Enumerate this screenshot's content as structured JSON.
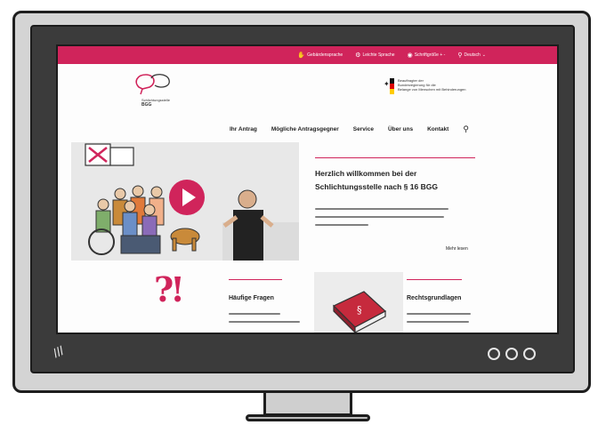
{
  "site": {
    "topbar": {
      "items": [
        {
          "icon": "sign-language-icon",
          "label": "Gebärdensprache"
        },
        {
          "icon": "easy-language-icon",
          "label": "Leichte Sprache"
        },
        {
          "icon": "font-size-icon",
          "label": "Schriftgröße  + -"
        },
        {
          "icon": "globe-icon",
          "label": "Deutsch"
        }
      ],
      "color": "#d0245b"
    },
    "logo": {
      "small_text": "Schlichtungsstelle",
      "big_text": "BGG"
    },
    "ministry": {
      "lines": [
        "Beauftragter der",
        "Bundesregierung für die",
        "Belange von Menschen mit Behinderungen"
      ]
    },
    "nav": {
      "items": [
        "Ihr Antrag",
        "Mögliche Antragsgegner",
        "Service",
        "Über uns",
        "Kontakt"
      ]
    },
    "hero": {
      "title": "Herzlich willkommen bei der Schlichtungsstelle nach § 16 BGG",
      "more": "Mehr lesen"
    },
    "cards": [
      {
        "title": "Häufige Fragen"
      },
      {
        "title": "Rechtsgrundlagen"
      }
    ]
  }
}
